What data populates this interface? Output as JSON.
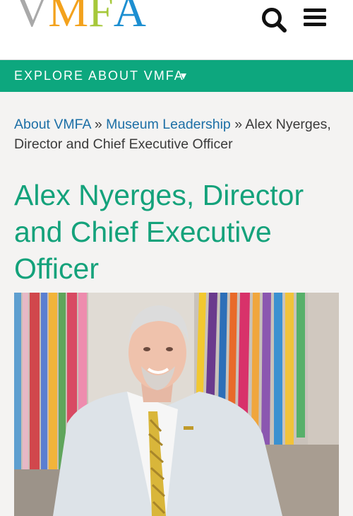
{
  "header": {
    "logo_letters": [
      "V",
      "M",
      "F",
      "A"
    ],
    "logo_colors": [
      "#a9a9a9",
      "#f3a21d",
      "#a6c83a",
      "#1d8fd1"
    ],
    "search_icon": "search-icon",
    "menu_icon": "hamburger-menu-icon"
  },
  "nav": {
    "explore_label": "EXPLORE ABOUT VMFA",
    "explore_caret": "▼"
  },
  "breadcrumb": {
    "link_1": "About VMFA",
    "sep_1": " » ",
    "link_2": "Museum Leadership",
    "sep_2": " » ",
    "current": "Alex Nyerges, Director and Chief Executive Officer"
  },
  "page": {
    "title": "Alex Nyerges, Director and Chief Executive Officer"
  },
  "colors": {
    "accent_green": "#0da77e",
    "title_green": "#14a27b",
    "link_blue": "#1c6fa6"
  }
}
